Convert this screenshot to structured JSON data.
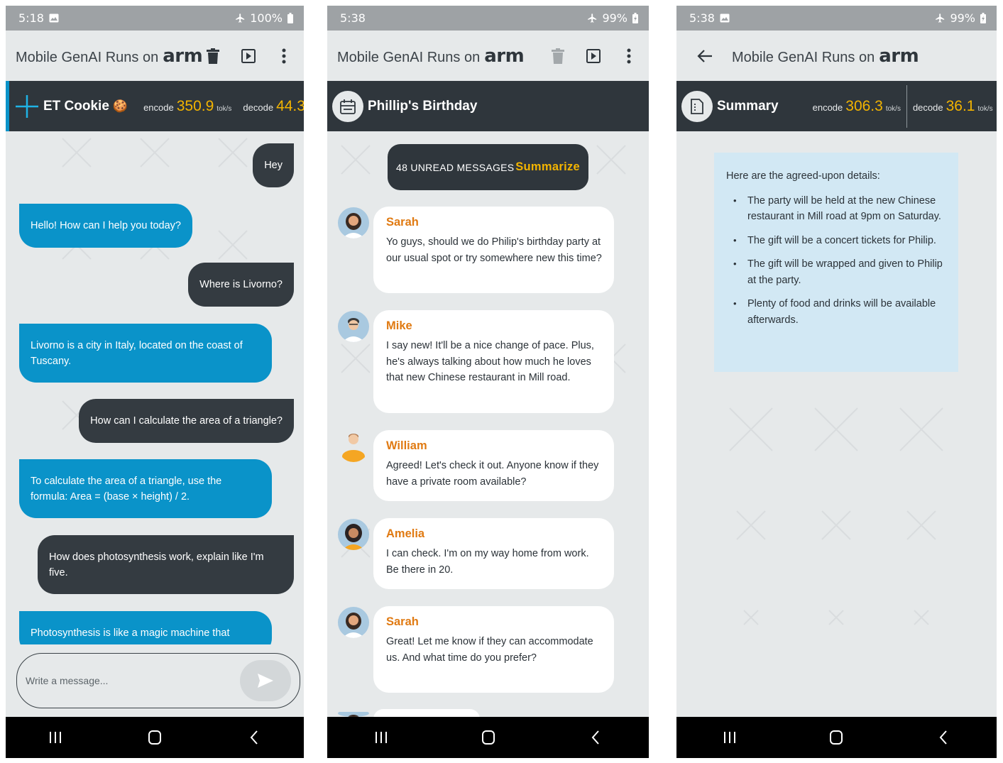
{
  "brand": {
    "prefix": "Mobile GenAI Runs on",
    "logo": "arm"
  },
  "screen1": {
    "status": {
      "time": "5:18",
      "battery": "100%"
    },
    "header": {
      "title": "ET Cookie",
      "emoji": "🍪",
      "encode_label": "encode",
      "encode_value": "350.9",
      "decode_label": "decode",
      "decode_value": "44.3",
      "unit": "tok/s"
    },
    "messages": [
      {
        "role": "user",
        "text": "Hey"
      },
      {
        "role": "bot",
        "text": "Hello! How can I help you today?"
      },
      {
        "role": "user",
        "text": "Where is Livorno?"
      },
      {
        "role": "bot",
        "text": "Livorno is a city in Italy, located on the coast of Tuscany."
      },
      {
        "role": "user",
        "text": "How can I calculate the area of a triangle?"
      },
      {
        "role": "bot",
        "text": "To calculate the area of a triangle, use the formula: Area = (base × height) / 2."
      },
      {
        "role": "user",
        "text": "How does photosynthesis work, explain like I'm five."
      },
      {
        "role": "bot",
        "text": "Photosynthesis is like a magic machine that"
      }
    ],
    "input_placeholder": "Write a message..."
  },
  "screen2": {
    "status": {
      "time": "5:38",
      "battery": "99%"
    },
    "header": {
      "title": "Phillip's Birthday"
    },
    "unread": {
      "label": "48 UNREAD MESSAGES",
      "action": "Summarize"
    },
    "messages": [
      {
        "name": "Sarah",
        "text": "Yo guys, should we do Philip's birthday party at our usual spot or try somewhere new this time?"
      },
      {
        "name": "Mike",
        "text": "I say new! It'll be a nice change of pace. Plus, he's always talking about how much he loves that new Chinese restaurant in Mill road."
      },
      {
        "name": "William",
        "text": "Agreed! Let's check it out. Anyone know if they have a private room available?"
      },
      {
        "name": "Amelia",
        "text": "I can check. I'm on my way home from work. Be there in 20."
      },
      {
        "name": "Sarah",
        "text": "Great! Let me know if they can accommodate us. And what time do you prefer?"
      }
    ]
  },
  "screen3": {
    "status": {
      "time": "5:38",
      "battery": "99%"
    },
    "header": {
      "title": "Summary",
      "encode_label": "encode",
      "encode_value": "306.3",
      "decode_label": "decode",
      "decode_value": "36.1",
      "unit": "tok/s"
    },
    "summary": {
      "intro": "Here are the agreed-upon details:",
      "points": [
        "The party will be held at the new Chinese restaurant in Mill road at 9pm on Saturday.",
        "The gift will be a concert tickets for Philip.",
        "The gift will be wrapped and given to Philip at the party.",
        "Plenty of food and drinks will be available afterwards."
      ]
    }
  },
  "colors": {
    "dark": "#2f363c",
    "blue": "#0a93c9",
    "accent": "#f3b400",
    "name": "#e07a12",
    "bg": "#e6e9ea"
  }
}
